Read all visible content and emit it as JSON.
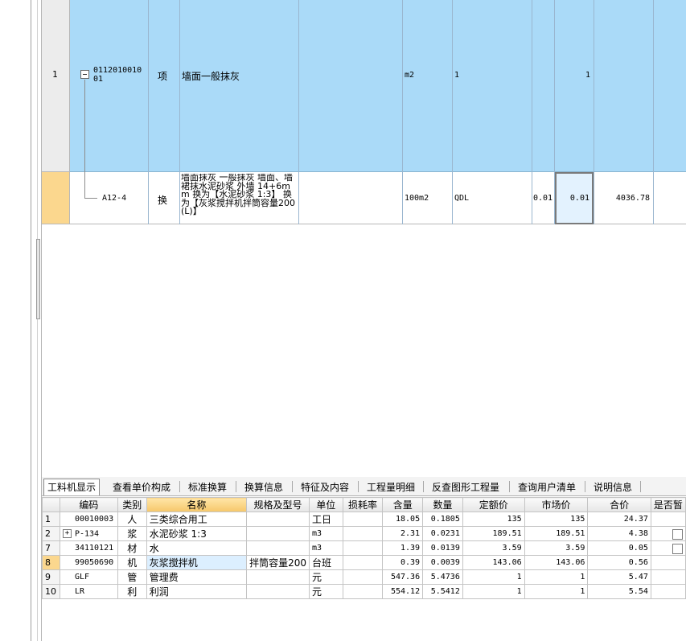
{
  "upper_grid": {
    "row1": {
      "index": "1",
      "code": "011201001001",
      "category": "项",
      "name": "墙面一般抹灰",
      "unit": "m2",
      "expr": "1",
      "qty": "1",
      "bg_color": "#aadaf8"
    },
    "row2": {
      "code": "A12-4",
      "category": "换",
      "name": "墙面抹灰 一般抹灰 墙面、墙裙抹水泥砂浆 外墙 14+6mm 换为【水泥砂浆 1:3】 换为【灰浆搅拌机拌筒容量200(L)】",
      "unit": "100m2",
      "expr": "QDL",
      "content": "0.01",
      "qty": "0.01",
      "price": "4036.78",
      "marker_color": "#fbd78e"
    }
  },
  "tabs": [
    {
      "label": "工料机显示",
      "active": true
    },
    {
      "label": "查看单价构成"
    },
    {
      "label": "标准换算"
    },
    {
      "label": "换算信息"
    },
    {
      "label": "特征及内容"
    },
    {
      "label": "工程量明细"
    },
    {
      "label": "反查图形工程量"
    },
    {
      "label": "查询用户清单"
    },
    {
      "label": "说明信息"
    }
  ],
  "lower_table": {
    "headers": [
      "编码",
      "类别",
      "名称",
      "规格及型号",
      "单位",
      "损耗率",
      "含量",
      "数量",
      "定额价",
      "市场价",
      "合价",
      "是否暂"
    ],
    "rows": [
      {
        "n": "1",
        "code": "00010003",
        "type": "人",
        "name": "三类综合用工",
        "spec": "",
        "unit": "工日",
        "loss": "",
        "content": "18.05",
        "qty": "0.1805",
        "quota": "135",
        "market": "135",
        "total": "24.37"
      },
      {
        "n": "2",
        "code": "P-134",
        "type": "浆",
        "name": "水泥砂浆 1:3",
        "spec": "",
        "unit": "m3",
        "loss": "",
        "content": "2.31",
        "qty": "0.0231",
        "quota": "189.51",
        "market": "189.51",
        "total": "4.38"
      },
      {
        "n": "7",
        "code": "34110121",
        "type": "材",
        "name": "水",
        "spec": "",
        "unit": "m3",
        "loss": "",
        "content": "1.39",
        "qty": "0.0139",
        "quota": "3.59",
        "market": "3.59",
        "total": "0.05"
      },
      {
        "n": "8",
        "code": "99050690",
        "type": "机",
        "name": "灰浆搅拌机",
        "spec": "拌筒容量200",
        "unit": "台班",
        "loss": "",
        "content": "0.39",
        "qty": "0.0039",
        "quota": "143.06",
        "market": "143.06",
        "total": "0.56"
      },
      {
        "n": "9",
        "code": "GLF",
        "type": "管",
        "name": "管理费",
        "spec": "",
        "unit": "元",
        "loss": "",
        "content": "547.36",
        "qty": "5.4736",
        "quota": "1",
        "market": "1",
        "total": "5.47"
      },
      {
        "n": "10",
        "code": "LR",
        "type": "利",
        "name": "利润",
        "spec": "",
        "unit": "元",
        "loss": "",
        "content": "554.12",
        "qty": "5.5412",
        "quota": "1",
        "market": "1",
        "total": "5.54"
      }
    ]
  }
}
